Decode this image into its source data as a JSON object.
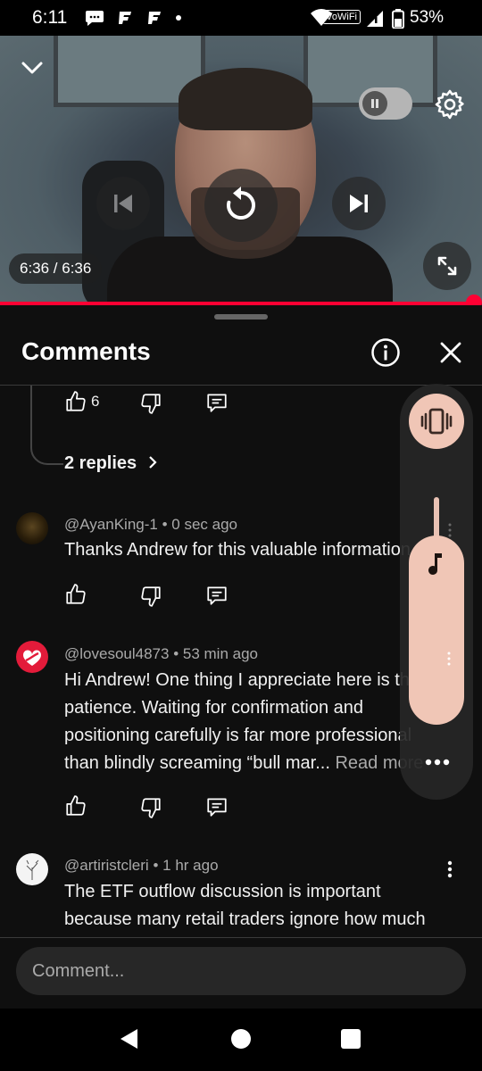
{
  "status_bar": {
    "time": "6:11",
    "notif_icons": [
      "chat-bubble-icon",
      "f-icon",
      "f-icon",
      "dot-icon"
    ],
    "vowifi": "VoWiFi",
    "battery": "53%"
  },
  "player": {
    "timecode": "6:36 / 6:36",
    "progress": 1.0,
    "accent": "#ff0033"
  },
  "comments": {
    "title": "Comments",
    "prev_thread": {
      "likes": "6",
      "replies": "2 replies"
    },
    "items": [
      {
        "author": "@AyanKing-1",
        "time": "0 sec ago",
        "text": "Thanks Andrew for this valuable information"
      },
      {
        "author": "@lovesoul4873",
        "time": "53 min ago",
        "lines": [
          "Hi Andrew! One thing I appreciate here is the",
          "patience. Waiting for confirmation and",
          "positioning carefully is far more professional",
          "than blindly screaming “bull mar..."
        ],
        "read_more": "Read more"
      },
      {
        "author": "@artiristcleri",
        "time": "1 hr ago",
        "lines": [
          "The ETF outflow discussion is important",
          "because many retail traders ignore how much"
        ]
      }
    ],
    "separator": "•"
  },
  "input": {
    "placeholder": "Comment..."
  },
  "volume_panel": {
    "mode_icon": "vibrate-icon",
    "music_icon": "music-note-icon",
    "accent": "#f0c6b6"
  }
}
